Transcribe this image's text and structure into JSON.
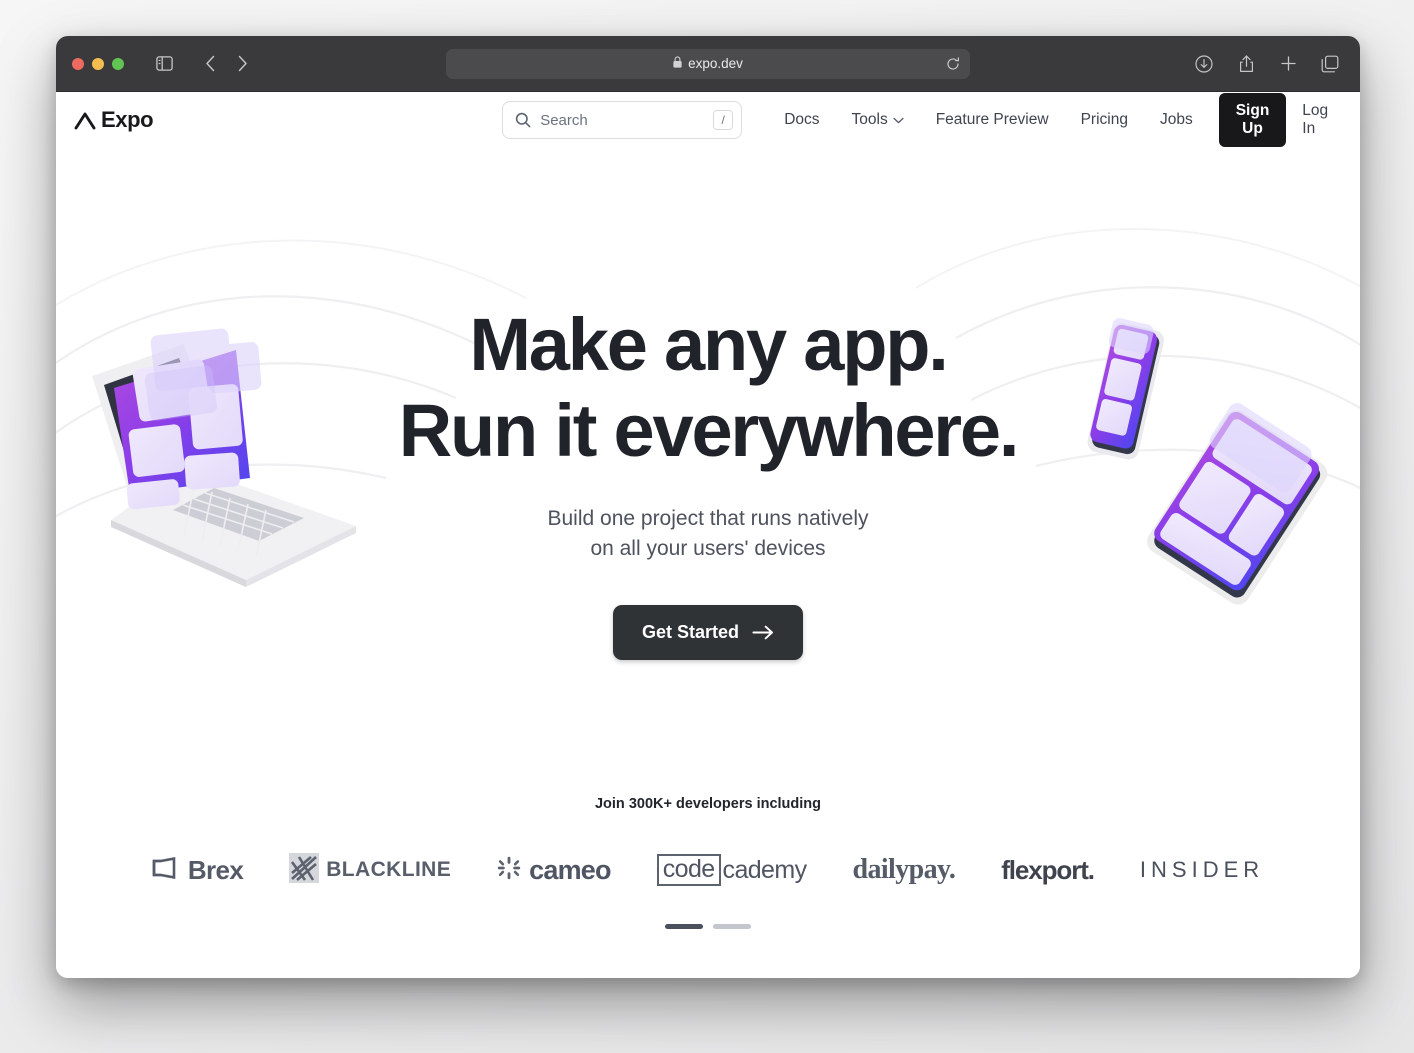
{
  "browser": {
    "url": "expo.dev",
    "icons": {
      "sidebar": "sidebar-toggle-icon",
      "back": "back-arrow-icon",
      "forward": "forward-arrow-icon",
      "shield": "privacy-shield-icon",
      "lock": "lock-icon",
      "reload": "reload-icon",
      "downloads": "downloads-icon",
      "share": "share-icon",
      "newtab": "new-tab-icon",
      "tabs": "tab-overview-icon"
    }
  },
  "site": {
    "logo_text": "Expo",
    "search": {
      "placeholder": "Search",
      "value": "",
      "shortcut": "/"
    },
    "nav": [
      {
        "label": "Docs",
        "has_caret": false
      },
      {
        "label": "Tools",
        "has_caret": true
      },
      {
        "label": "Feature Preview",
        "has_caret": false
      },
      {
        "label": "Pricing",
        "has_caret": false
      },
      {
        "label": "Jobs",
        "has_caret": false
      }
    ],
    "signup_label": "Sign Up",
    "login_label": "Log In"
  },
  "hero": {
    "headline_line1": "Make any app.",
    "headline_line2": "Run it everywhere.",
    "subtitle_line1": "Build one project that runs natively",
    "subtitle_line2": "on all your users' devices",
    "cta_label": "Get Started"
  },
  "social_proof": {
    "title": "Join 300K+ developers including",
    "logos": [
      {
        "name": "Brex",
        "text": "Brex"
      },
      {
        "name": "BlackLine",
        "text": "BLACKLINE"
      },
      {
        "name": "Cameo",
        "text": "cameo"
      },
      {
        "name": "Codecademy",
        "text_boxed": "code",
        "text_rest": "cademy"
      },
      {
        "name": "DailyPay",
        "text": "dailypay."
      },
      {
        "name": "Flexport",
        "text": "flexport."
      },
      {
        "name": "Insider",
        "text": "INSIDER"
      }
    ],
    "carousel": {
      "slides": 2,
      "active_index": 0
    }
  },
  "colors": {
    "accent_purple": "#7c3aed",
    "accent_violet": "#5b4bf5",
    "dark": "#18181b",
    "cta": "#2f3336",
    "toolbar": "#3a3a3c"
  }
}
